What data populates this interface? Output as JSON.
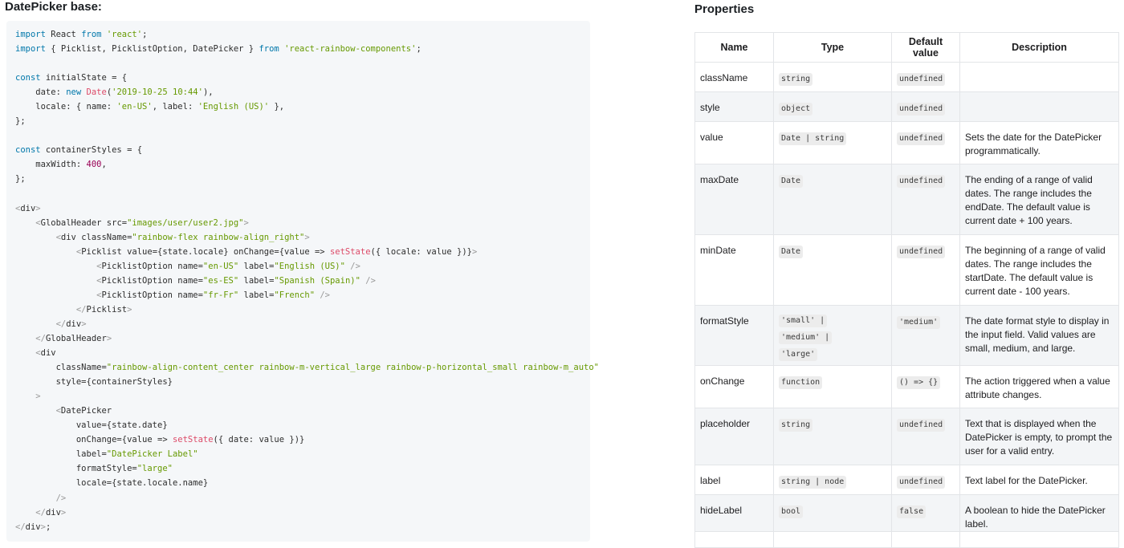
{
  "left_title": "DatePicker base:",
  "right_title": "Properties",
  "code_lines": [
    [
      {
        "t": "import",
        "c": "kw"
      },
      {
        "t": " React ",
        "c": ""
      },
      {
        "t": "from",
        "c": "kw"
      },
      {
        "t": " ",
        "c": ""
      },
      {
        "t": "'react'",
        "c": "str"
      },
      {
        "t": ";",
        "c": ""
      }
    ],
    [
      {
        "t": "import",
        "c": "kw"
      },
      {
        "t": " { Picklist, PicklistOption, DatePicker } ",
        "c": ""
      },
      {
        "t": "from",
        "c": "kw"
      },
      {
        "t": " ",
        "c": ""
      },
      {
        "t": "'react-rainbow-components'",
        "c": "str"
      },
      {
        "t": ";",
        "c": ""
      }
    ],
    [],
    [
      {
        "t": "const",
        "c": "kw"
      },
      {
        "t": " initialState = {",
        "c": ""
      }
    ],
    [
      {
        "t": "    date",
        "c": ""
      },
      {
        "t": ": ",
        "c": ""
      },
      {
        "t": "new",
        "c": "kw"
      },
      {
        "t": " ",
        "c": ""
      },
      {
        "t": "Date",
        "c": "fn"
      },
      {
        "t": "(",
        "c": ""
      },
      {
        "t": "'2019-10-25 10:44'",
        "c": "str"
      },
      {
        "t": "),",
        "c": ""
      }
    ],
    [
      {
        "t": "    locale",
        "c": ""
      },
      {
        "t": ": { name: ",
        "c": ""
      },
      {
        "t": "'en-US'",
        "c": "str"
      },
      {
        "t": ", label: ",
        "c": ""
      },
      {
        "t": "'English (US)'",
        "c": "str"
      },
      {
        "t": " },",
        "c": ""
      }
    ],
    [
      {
        "t": "};",
        "c": ""
      }
    ],
    [],
    [
      {
        "t": "const",
        "c": "kw"
      },
      {
        "t": " containerStyles = {",
        "c": ""
      }
    ],
    [
      {
        "t": "    maxWidth",
        "c": ""
      },
      {
        "t": ": ",
        "c": ""
      },
      {
        "t": "400",
        "c": "num"
      },
      {
        "t": ",",
        "c": ""
      }
    ],
    [
      {
        "t": "};",
        "c": ""
      }
    ],
    [],
    [
      {
        "t": "<",
        "c": "tag"
      },
      {
        "t": "div",
        "c": ""
      },
      {
        "t": ">",
        "c": "tag"
      }
    ],
    [
      {
        "t": "    ",
        "c": ""
      },
      {
        "t": "<",
        "c": "tag"
      },
      {
        "t": "GlobalHeader src=",
        "c": ""
      },
      {
        "t": "\"images/user/user2.jpg\"",
        "c": "str"
      },
      {
        "t": ">",
        "c": "tag"
      }
    ],
    [
      {
        "t": "        ",
        "c": ""
      },
      {
        "t": "<",
        "c": "tag"
      },
      {
        "t": "div className=",
        "c": ""
      },
      {
        "t": "\"rainbow-flex rainbow-align_right\"",
        "c": "str"
      },
      {
        "t": ">",
        "c": "tag"
      }
    ],
    [
      {
        "t": "            ",
        "c": ""
      },
      {
        "t": "<",
        "c": "tag"
      },
      {
        "t": "Picklist value={state.locale} onChange={value => ",
        "c": ""
      },
      {
        "t": "setState",
        "c": "fn"
      },
      {
        "t": "({ locale: value })}",
        "c": ""
      },
      {
        "t": ">",
        "c": "tag"
      }
    ],
    [
      {
        "t": "                ",
        "c": ""
      },
      {
        "t": "<",
        "c": "tag"
      },
      {
        "t": "PicklistOption name=",
        "c": ""
      },
      {
        "t": "\"en-US\"",
        "c": "str"
      },
      {
        "t": " label=",
        "c": ""
      },
      {
        "t": "\"English (US)\"",
        "c": "str"
      },
      {
        "t": " />",
        "c": "tag"
      }
    ],
    [
      {
        "t": "                ",
        "c": ""
      },
      {
        "t": "<",
        "c": "tag"
      },
      {
        "t": "PicklistOption name=",
        "c": ""
      },
      {
        "t": "\"es-ES\"",
        "c": "str"
      },
      {
        "t": " label=",
        "c": ""
      },
      {
        "t": "\"Spanish (Spain)\"",
        "c": "str"
      },
      {
        "t": " />",
        "c": "tag"
      }
    ],
    [
      {
        "t": "                ",
        "c": ""
      },
      {
        "t": "<",
        "c": "tag"
      },
      {
        "t": "PicklistOption name=",
        "c": ""
      },
      {
        "t": "\"fr-Fr\"",
        "c": "str"
      },
      {
        "t": " label=",
        "c": ""
      },
      {
        "t": "\"French\"",
        "c": "str"
      },
      {
        "t": " />",
        "c": "tag"
      }
    ],
    [
      {
        "t": "            ",
        "c": ""
      },
      {
        "t": "</",
        "c": "tag"
      },
      {
        "t": "Picklist",
        "c": ""
      },
      {
        "t": ">",
        "c": "tag"
      }
    ],
    [
      {
        "t": "        ",
        "c": ""
      },
      {
        "t": "</",
        "c": "tag"
      },
      {
        "t": "div",
        "c": ""
      },
      {
        "t": ">",
        "c": "tag"
      }
    ],
    [
      {
        "t": "    ",
        "c": ""
      },
      {
        "t": "</",
        "c": "tag"
      },
      {
        "t": "GlobalHeader",
        "c": ""
      },
      {
        "t": ">",
        "c": "tag"
      }
    ],
    [
      {
        "t": "    ",
        "c": ""
      },
      {
        "t": "<",
        "c": "tag"
      },
      {
        "t": "div",
        "c": ""
      }
    ],
    [
      {
        "t": "        className=",
        "c": ""
      },
      {
        "t": "\"rainbow-align-content_center rainbow-m-vertical_large rainbow-p-horizontal_small rainbow-m_auto\"",
        "c": "str"
      }
    ],
    [
      {
        "t": "        style={containerStyles}",
        "c": ""
      }
    ],
    [
      {
        "t": "    ",
        "c": ""
      },
      {
        "t": ">",
        "c": "tag"
      }
    ],
    [
      {
        "t": "        ",
        "c": ""
      },
      {
        "t": "<",
        "c": "tag"
      },
      {
        "t": "DatePicker",
        "c": ""
      }
    ],
    [
      {
        "t": "            value={state.date}",
        "c": ""
      }
    ],
    [
      {
        "t": "            onChange={value => ",
        "c": ""
      },
      {
        "t": "setState",
        "c": "fn"
      },
      {
        "t": "({ date: value })}",
        "c": ""
      }
    ],
    [
      {
        "t": "            label=",
        "c": ""
      },
      {
        "t": "\"DatePicker Label\"",
        "c": "str"
      }
    ],
    [
      {
        "t": "            formatStyle=",
        "c": ""
      },
      {
        "t": "\"large\"",
        "c": "str"
      }
    ],
    [
      {
        "t": "            locale={state.locale.name}",
        "c": ""
      }
    ],
    [
      {
        "t": "        ",
        "c": ""
      },
      {
        "t": "/>",
        "c": "tag"
      }
    ],
    [
      {
        "t": "    ",
        "c": ""
      },
      {
        "t": "</",
        "c": "tag"
      },
      {
        "t": "div",
        "c": ""
      },
      {
        "t": ">",
        "c": "tag"
      }
    ],
    [
      {
        "t": "</",
        "c": "tag"
      },
      {
        "t": "div",
        "c": ""
      },
      {
        "t": ">",
        "c": "tag"
      },
      {
        "t": ";",
        "c": ""
      }
    ]
  ],
  "table": {
    "headers": [
      "Name",
      "Type",
      "Default value",
      "Description"
    ],
    "rows": [
      {
        "name": "className",
        "type": [
          "string"
        ],
        "default": "undefined",
        "description": ""
      },
      {
        "name": "style",
        "type": [
          "object"
        ],
        "default": "undefined",
        "description": ""
      },
      {
        "name": "value",
        "type": [
          "Date | string"
        ],
        "default": "undefined",
        "description": "Sets the date for the DatePicker programmatically."
      },
      {
        "name": "maxDate",
        "type": [
          "Date"
        ],
        "default": "undefined",
        "description": "The ending of a range of valid dates. The range includes the endDate. The default value is current date + 100 years."
      },
      {
        "name": "minDate",
        "type": [
          "Date"
        ],
        "default": "undefined",
        "description": "The beginning of a range of valid dates. The range includes the startDate. The default value is current date - 100 years."
      },
      {
        "name": "formatStyle",
        "type": [
          "'small' |",
          "'medium' |",
          "'large'"
        ],
        "default": "'medium'",
        "description": "The date format style to display in the input field. Valid values are small, medium, and large."
      },
      {
        "name": "onChange",
        "type": [
          "function"
        ],
        "default": "() => {}",
        "description": "The action triggered when a value attribute changes."
      },
      {
        "name": "placeholder",
        "type": [
          "string"
        ],
        "default": "undefined",
        "description": "Text that is displayed when the DatePicker is empty, to prompt the user for a valid entry."
      },
      {
        "name": "label",
        "type": [
          "string | node"
        ],
        "default": "undefined",
        "description": "Text label for the DatePicker."
      },
      {
        "name": "hideLabel",
        "type": [
          "bool"
        ],
        "default": "false",
        "description": "A boolean to hide the DatePicker label."
      },
      {
        "name": "",
        "type": [],
        "default": "",
        "description": ""
      }
    ]
  }
}
